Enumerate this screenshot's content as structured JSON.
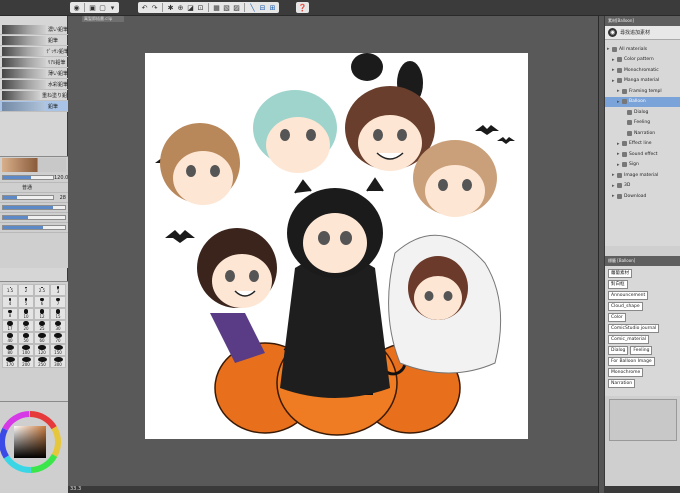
{
  "toolbar": {
    "icons": [
      "canvas-icon",
      "save-icon",
      "new-icon",
      "undo-icon",
      "redo-icon",
      "clear-icon",
      "transform-icon",
      "fill-icon",
      "select-icon",
      "help-icon"
    ]
  },
  "left_panel": {
    "brush_names": [
      "濃い鉛筆",
      "鉛筆",
      "ﾃﾞｯｻﾝ鉛筆",
      "ﾘｱﾙ鉛筆",
      "薄い鉛筆",
      "水彩鉛筆",
      "重ね塗り鉛筆",
      "鉛筆"
    ],
    "tool_property": {
      "size_value": "120.0",
      "blend_label": "普通",
      "density_value": "28"
    },
    "brush_sizes": [
      "1.5",
      "2",
      "2.5",
      "3",
      "4",
      "5",
      "6",
      "7",
      "8",
      "10",
      "12",
      "15",
      "17",
      "20",
      "25",
      "30",
      "40",
      "50",
      "60",
      "70",
      "80",
      "100",
      "120",
      "150",
      "170",
      "200",
      "250",
      "300"
    ]
  },
  "document": {
    "tab_label": "萬聖節插畫.clip",
    "zoom": "33.3"
  },
  "right_panel": {
    "panel_header": "素材[Balloon]",
    "title": "尋找追加素材",
    "tree": [
      {
        "label": "All materials",
        "depth": 0
      },
      {
        "label": "Color pattern",
        "depth": 1
      },
      {
        "label": "Monochromatic",
        "depth": 1
      },
      {
        "label": "Manga material",
        "depth": 1
      },
      {
        "label": "Framing templ",
        "depth": 2
      },
      {
        "label": "Balloon",
        "depth": 2,
        "selected": true
      },
      {
        "label": "Dialog",
        "depth": 3
      },
      {
        "label": "Feeling",
        "depth": 3
      },
      {
        "label": "Narration",
        "depth": 3
      },
      {
        "label": "Effect line",
        "depth": 2
      },
      {
        "label": "Sound effect",
        "depth": 2
      },
      {
        "label": "Sign",
        "depth": 2
      },
      {
        "label": "Image material",
        "depth": 1
      },
      {
        "label": "3D",
        "depth": 1
      },
      {
        "label": "Download",
        "depth": 1
      }
    ],
    "tag_header": "標籤 [Balloon]",
    "tags": [
      [
        "蘿蔔素材"
      ],
      [
        "對白框"
      ],
      [
        "Announcement"
      ],
      [
        "Cloud_shape"
      ],
      [
        "Color"
      ],
      [
        "ComicStudio journal"
      ],
      [
        "Comic_material"
      ],
      [
        "Dialog",
        "Feeling"
      ],
      [
        "For Balloon Image"
      ],
      [
        "Monochrome"
      ],
      [
        "Narration"
      ]
    ]
  },
  "colors": {
    "accent": "#5d89c7",
    "selection": "#7aa3d9",
    "pumpkin": "#e8701c"
  }
}
